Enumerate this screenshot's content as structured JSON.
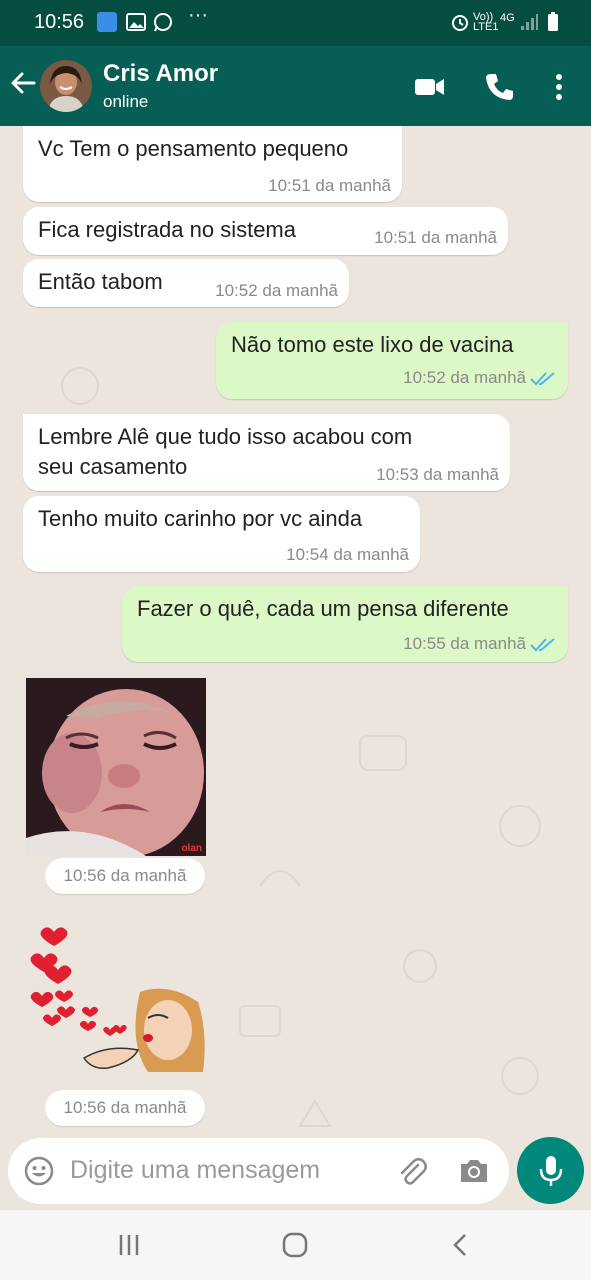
{
  "status_bar": {
    "time": "10:56",
    "network": "Vo)) LTE1",
    "signal_type": "4G"
  },
  "header": {
    "contact_name": "Cris Amor",
    "contact_status": "online"
  },
  "messages": [
    {
      "direction": "in",
      "text": "Vc Tem o pensamento pequeno",
      "time": "10:51 da manhã"
    },
    {
      "direction": "in",
      "text": "Fica registrada  no sistema",
      "time": "10:51 da manhã"
    },
    {
      "direction": "in",
      "text": "Então tabom",
      "time": "10:52 da manhã"
    },
    {
      "direction": "out",
      "text": "Não tomo este lixo de vacina",
      "time": "10:52 da manhã",
      "status": "read"
    },
    {
      "direction": "in",
      "text": "Lembre Alê que tudo isso acabou com\nseu casamento",
      "time": "10:53 da manhã"
    },
    {
      "direction": "in",
      "text": "Tenho muito carinho por vc ainda",
      "time": "10:54 da manhã"
    },
    {
      "direction": "out",
      "text": "Fazer o quê, cada um pensa diferente",
      "time": "10:55 da manhã",
      "status": "read"
    },
    {
      "direction": "in",
      "type": "sticker",
      "sticker": "sad-baby-sticker",
      "watermark": "olan",
      "time": "10:56 da manhã"
    },
    {
      "direction": "in",
      "type": "sticker",
      "sticker": "blowing-kisses-sticker",
      "time": "10:56 da manhã"
    }
  ],
  "input": {
    "placeholder": "Digite uma mensagem"
  },
  "colors": {
    "header": "#075e54",
    "status_bar": "#064d41",
    "outgoing_bubble": "#dcf8c6",
    "incoming_bubble": "#ffffff",
    "chat_background": "#ece5dd",
    "read_ticks": "#4fb6ec",
    "mic_button": "#00897b"
  },
  "icons": {
    "back": "arrow-left-icon",
    "video": "video-camera-icon",
    "call": "phone-icon",
    "menu": "more-vertical-icon",
    "emoji": "emoji-icon",
    "attach": "paperclip-icon",
    "camera": "camera-icon",
    "mic": "microphone-icon"
  }
}
